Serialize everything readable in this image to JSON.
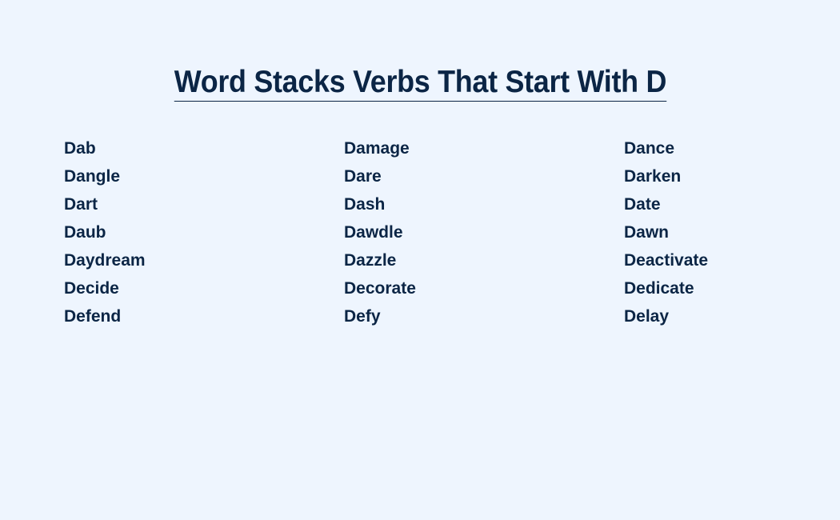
{
  "title": "Word Stacks Verbs That Start With D",
  "words": [
    "Dab",
    "Damage",
    "Dance",
    "Dangle",
    "Dare",
    "Darken",
    "Dart",
    "Dash",
    "Date",
    "Daub",
    "Dawdle",
    "Dawn",
    "Daydream",
    "Dazzle",
    "Deactivate",
    "Decide",
    "Decorate",
    "Dedicate",
    "Defend",
    "Defy",
    "Delay"
  ],
  "colors": {
    "background": "#eef5fe",
    "text": "#0b2545"
  }
}
